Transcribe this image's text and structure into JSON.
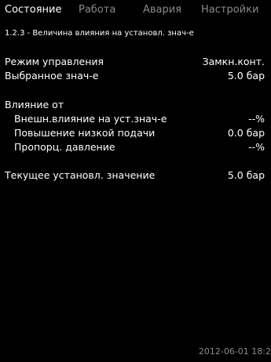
{
  "tabs": [
    {
      "label": "Состояние",
      "active": true
    },
    {
      "label": "Работа",
      "active": false
    },
    {
      "label": "Авария",
      "active": false
    },
    {
      "label": "Настройки",
      "active": false
    }
  ],
  "breadcrumb": "1.2.3 - Величина влияния на установл. знач-е",
  "rows": {
    "control_mode": {
      "label": "Режим управления",
      "value": "Замкн.конт."
    },
    "selected_value": {
      "label": "Выбранное знач-е",
      "value": "5.0 бар"
    },
    "influence_header": {
      "label": "Влияние от"
    },
    "ext_influence": {
      "label": "Внешн.влияние на уст.знач-е",
      "value": "--%"
    },
    "low_flow_boost": {
      "label": "Повышение низкой подачи",
      "value": "0.0 бар"
    },
    "prop_pressure": {
      "label": "Пропорц. давление",
      "value": "--%"
    },
    "current_setpoint": {
      "label": "Текущее установл. значение",
      "value": "5.0 бар"
    }
  },
  "footer": {
    "datetime": "2012-06-01 18:2"
  },
  "colors": {
    "background": "#000000",
    "text": "#ffffff",
    "inactive_text": "#8a8a8a"
  }
}
